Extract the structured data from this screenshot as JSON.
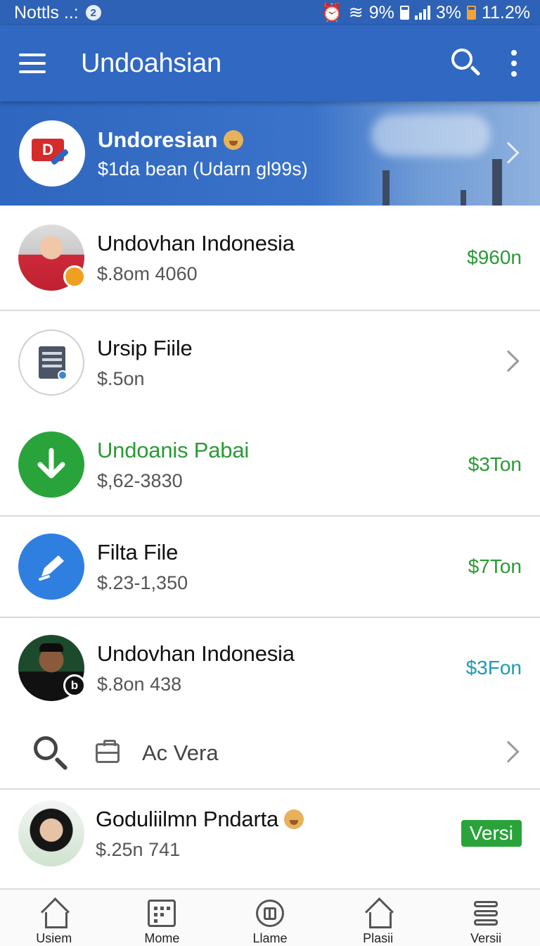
{
  "status_bar": {
    "left_text": "Nottls ..:",
    "notif_badge": "2",
    "wifi_pct": "9%",
    "signal_pct": "3%",
    "battery_pct": "11.2%"
  },
  "app_bar": {
    "title": "Undoahsian"
  },
  "banner": {
    "title": "Undoresian",
    "subtitle": "$1da bean (Udarn gl99s)",
    "logo_text": "D"
  },
  "list": {
    "items": [
      {
        "title": "Undovhan Indonesia",
        "subtitle": "$.8om 4060",
        "trailing": "$960n",
        "avatar": "person-red-shirt",
        "badge": "orange-badge"
      },
      {
        "title": "Ursip Fiile",
        "subtitle": "$.5on",
        "trailing": "",
        "avatar": "document-icon"
      },
      {
        "title": "Undoanis Pabai",
        "subtitle": "$,62-3830",
        "trailing": "$3Ton",
        "avatar": "download-arrow-icon"
      },
      {
        "title": "Filta File",
        "subtitle": "$.23-1,350",
        "trailing": "$7Ton",
        "avatar": "edit-pen-icon"
      },
      {
        "title": "Undovhan Indonesia",
        "subtitle": "$.8on 438",
        "trailing": "$3Fon",
        "avatar": "person-peci",
        "badge": "b"
      }
    ],
    "search_row": {
      "label": "Ac Vera"
    },
    "last_item": {
      "title": "Goduliilmn Pndarta",
      "subtitle": "$.25n 741",
      "badge": "Versi",
      "avatar": "person-hijab"
    }
  },
  "bottom_nav": {
    "items": [
      {
        "label": "Usiem",
        "icon": "home-icon"
      },
      {
        "label": "Mome",
        "icon": "calendar-icon"
      },
      {
        "label": "Llame",
        "icon": "grid-circle-icon"
      },
      {
        "label": "Plasii",
        "icon": "home-icon"
      },
      {
        "label": "Versii",
        "icon": "stack-icon"
      }
    ]
  },
  "colors": {
    "primary": "#3068c2",
    "green": "#2a9a34",
    "teal": "#1a9bb5",
    "badge_orange": "#f0a020"
  }
}
